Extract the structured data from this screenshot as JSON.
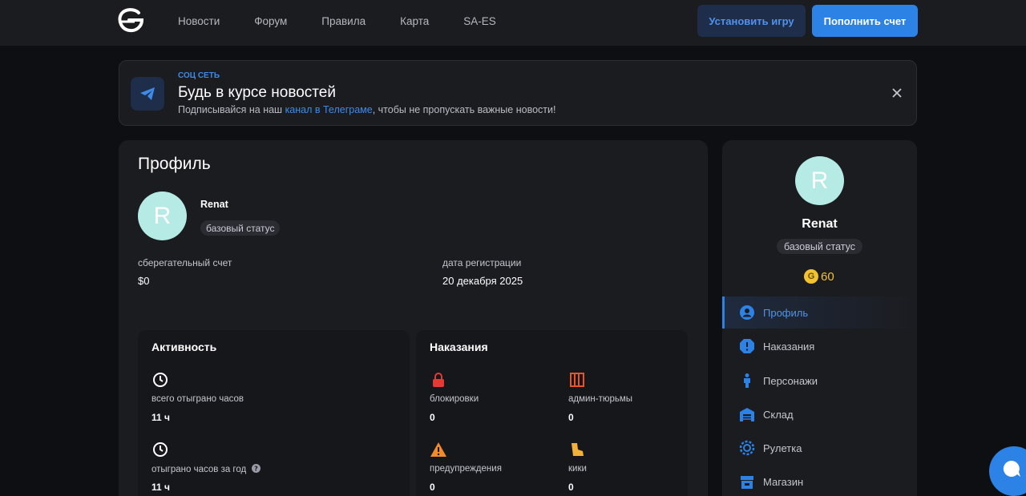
{
  "colors": {
    "accent": "#2d82e6",
    "bg": "#0e0f12",
    "panel": "#1b1c20",
    "avatar": "#b5ebe4",
    "coin": "#f2c230",
    "danger": "#e53935",
    "warn": "#f28b2c"
  },
  "header": {
    "nav": [
      "Новости",
      "Форум",
      "Правила",
      "Карта",
      "SA-ES"
    ],
    "install_label": "Установить игру",
    "topup_label": "Пополнить счет"
  },
  "banner": {
    "kicker": "СОЦ СЕТЬ",
    "title": "Будь в курсе новостей",
    "text_before": "Подписывайся на наш ",
    "link": "канал в Телеграме",
    "text_after": ", чтобы не пропускать важные новости!"
  },
  "profile": {
    "title": "Профиль",
    "avatar_letter": "R",
    "username": "Renat",
    "status": "базовый статус",
    "savings_label": "сберегательный счет",
    "savings_value": "$0",
    "reg_label": "дата регистрации",
    "reg_value": "20 декабря 2025"
  },
  "activity": {
    "title": "Активность",
    "items": [
      {
        "label": "всего отыграно часов",
        "value": "11 ч"
      },
      {
        "label": "отыграно часов за год",
        "value": "11 ч"
      }
    ]
  },
  "punishments": {
    "title": "Наказания",
    "items": [
      {
        "label": "блокировки",
        "value": "0"
      },
      {
        "label": "админ-тюрьмы",
        "value": "0"
      },
      {
        "label": "предупреждения",
        "value": "0"
      },
      {
        "label": "кики",
        "value": "0"
      }
    ]
  },
  "side": {
    "avatar_letter": "R",
    "username": "Renat",
    "status": "базовый статус",
    "coin_symbol": "G",
    "coins": "60",
    "menu": [
      {
        "label": "Профиль",
        "icon": "user-icon",
        "active": true
      },
      {
        "label": "Наказания",
        "icon": "alert-icon"
      },
      {
        "label": "Персонажи",
        "icon": "person-icon"
      },
      {
        "label": "Склад",
        "icon": "warehouse-icon"
      },
      {
        "label": "Рулетка",
        "icon": "roulette-icon"
      },
      {
        "label": "Магазин",
        "icon": "shop-icon"
      }
    ]
  }
}
